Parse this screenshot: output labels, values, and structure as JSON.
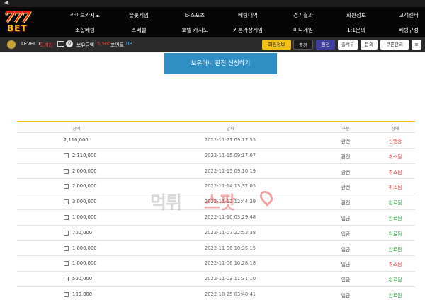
{
  "logo": {
    "number": "777",
    "brand": "BET"
  },
  "menu": [
    "라이브카지노",
    "슬롯게임",
    "E-스포츠",
    "베팅내역",
    "경기결과",
    "회원정보",
    "고객센터",
    "조합베팅",
    "스페셜",
    "호텔 카지노",
    "키론가상게임",
    "미니게임",
    "1:1문의",
    "베팅규정"
  ],
  "userbar": {
    "level": "LEVEL 1",
    "username": "도끼찬",
    "message_count": "0",
    "balance_label": "보유금액",
    "balance_value": "5,500",
    "points_label": "포인트",
    "points_value": "0P"
  },
  "buttons": {
    "member": "회원정보",
    "charge": "충전",
    "exchange": "환전",
    "attendance": "출석부",
    "ask": "문의",
    "coupon": "쿠폰관리",
    "more": "≡"
  },
  "main": {
    "request_button": "보유머니 환전 신청하기"
  },
  "table": {
    "headers": [
      "금액",
      "날짜",
      "구분",
      "상태"
    ],
    "rows": [
      {
        "amount": "2,110,000",
        "checkbox": false,
        "date": "2022-11-21 09:17:55",
        "type": "환전",
        "status": "진행중",
        "status_color": "#e23c3c"
      },
      {
        "amount": "2,110,000",
        "checkbox": true,
        "date": "2022-11-15 09:17:07",
        "type": "환전",
        "status": "취소됨",
        "status_color": "#e23c3c"
      },
      {
        "amount": "2,000,000",
        "checkbox": true,
        "date": "2022-11-15 09:10:19",
        "type": "환전",
        "status": "취소됨",
        "status_color": "#e23c3c"
      },
      {
        "amount": "2,000,000",
        "checkbox": true,
        "date": "2022-11-14 13:32:05",
        "type": "환전",
        "status": "취소됨",
        "status_color": "#e23c3c"
      },
      {
        "amount": "3,000,000",
        "checkbox": true,
        "date": "2022-11-12 12:44:39",
        "type": "환전",
        "status": "완료됨",
        "status_color": "#2f9e44"
      },
      {
        "amount": "1,000,000",
        "checkbox": true,
        "date": "2022-11-10 03:29:48",
        "type": "입금",
        "status": "완료됨",
        "status_color": "#2f9e44"
      },
      {
        "amount": "700,000",
        "checkbox": true,
        "date": "2022-11-07 22:52:38",
        "type": "입금",
        "status": "완료됨",
        "status_color": "#2f9e44"
      },
      {
        "amount": "1,000,000",
        "checkbox": true,
        "date": "2022-11-06 10:35:15",
        "type": "입금",
        "status": "완료됨",
        "status_color": "#2f9e44"
      },
      {
        "amount": "1,000,000",
        "checkbox": true,
        "date": "2022-11-06 10:28:18",
        "type": "입금",
        "status": "취소됨",
        "status_color": "#e23c3c"
      },
      {
        "amount": "500,000",
        "checkbox": true,
        "date": "2022-11-03 11:31:10",
        "type": "입금",
        "status": "완료됨",
        "status_color": "#2f9e44"
      },
      {
        "amount": "100,000",
        "checkbox": true,
        "date": "2022-10-25 03:40:41",
        "type": "입금",
        "status": "완료됨",
        "status_color": "#2f9e44"
      }
    ]
  },
  "watermark": {
    "part1": "먹튀",
    "part2": "스팟"
  }
}
